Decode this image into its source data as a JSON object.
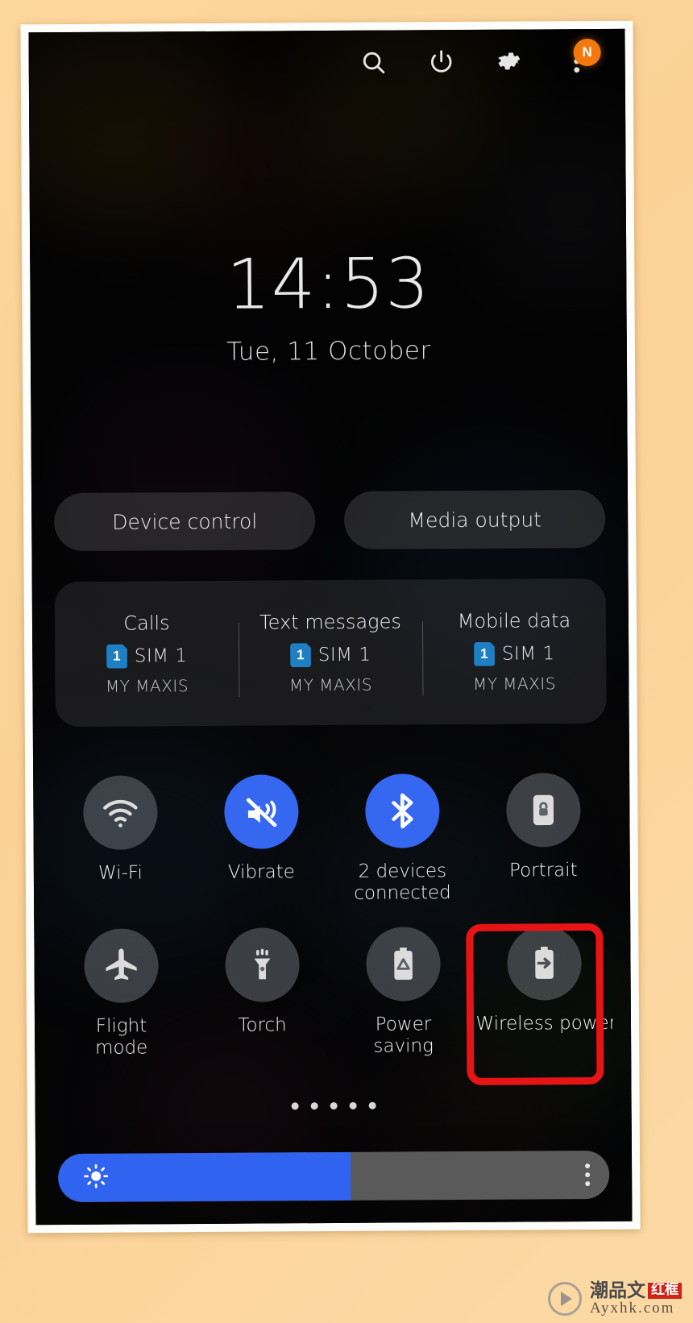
{
  "statusbar": {
    "icons": [
      {
        "name": "search-icon",
        "label": "Search"
      },
      {
        "name": "power-icon",
        "label": "Power"
      },
      {
        "name": "settings-gear-icon",
        "label": "Settings"
      },
      {
        "name": "more-options-icon",
        "label": "More options"
      }
    ],
    "badge": "N",
    "badge_color": "#f4790d"
  },
  "clock": {
    "time": "14:53",
    "date": "Tue, 11 October"
  },
  "shortcuts": {
    "device_control": "Device control",
    "media_output": "Media output"
  },
  "sim_panel": {
    "columns": [
      {
        "title": "Calls",
        "sim_chip": "1",
        "sim_label": "SIM 1",
        "carrier": "MY MAXIS"
      },
      {
        "title": "Text messages",
        "sim_chip": "1",
        "sim_label": "SIM 1",
        "carrier": "MY MAXIS"
      },
      {
        "title": "Mobile data",
        "sim_chip": "1",
        "sim_label": "SIM 1",
        "carrier": "MY MAXIS"
      }
    ]
  },
  "quick_settings": {
    "tiles": [
      {
        "icon": "wifi-icon",
        "label": "Wi-Fi",
        "state": "off"
      },
      {
        "icon": "vibrate-icon",
        "label": "Vibrate",
        "state": "on"
      },
      {
        "icon": "bluetooth-icon",
        "label": "2 devices\nconnected",
        "state": "on"
      },
      {
        "icon": "rotation-lock-icon",
        "label": "Portrait",
        "state": "off"
      },
      {
        "icon": "airplane-icon",
        "label": "Flight\nmode",
        "state": "off"
      },
      {
        "icon": "torch-icon",
        "label": "Torch",
        "state": "off"
      },
      {
        "icon": "power-saving-icon",
        "label": "Power\nsaving",
        "state": "off"
      },
      {
        "icon": "wireless-power-share-icon",
        "label": "Wireless power sharing",
        "state": "off"
      }
    ],
    "active_color": "#3667f0",
    "inactive_color": "#7d828a"
  },
  "pager": {
    "count": 5
  },
  "brightness": {
    "icon": "brightness-sun-icon",
    "value_percent": 53,
    "fill_color": "#2f63f0",
    "track_color": "#5a5a5a",
    "more_icon": "brightness-more-icon"
  },
  "annotation": {
    "target": "Wireless power sharing",
    "color": "#e61414"
  },
  "watermark": {
    "cn_text": "潮品文",
    "red_text": "红框",
    "url": "Ayxhk.com"
  }
}
